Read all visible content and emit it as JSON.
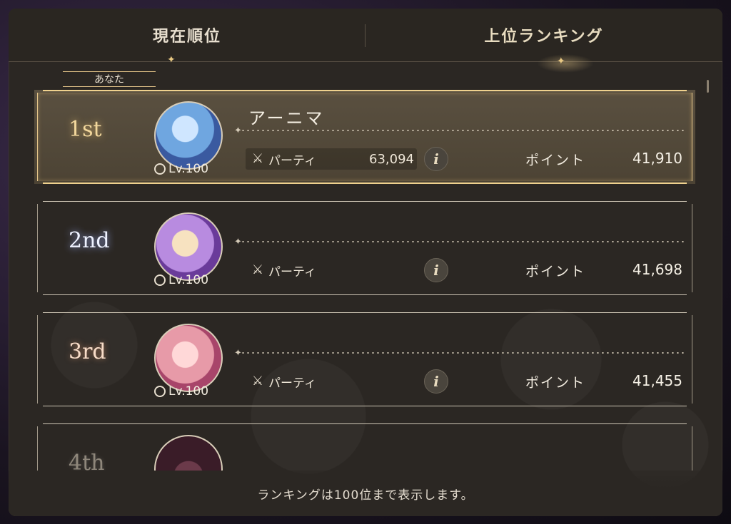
{
  "tabs": {
    "current": "現在順位",
    "top": "上位ランキング"
  },
  "you_tag": "あなた",
  "entries": [
    {
      "rank": "1st",
      "name": "アーニマ",
      "level": "Lv.100",
      "party_label": "パーティ",
      "party_value": "63,094",
      "point_label": "ポイント",
      "points": "41,910"
    },
    {
      "rank": "2nd",
      "name": "",
      "level": "Lv.100",
      "party_label": "パーティ",
      "party_value": "",
      "point_label": "ポイント",
      "points": "41,698"
    },
    {
      "rank": "3rd",
      "name": "",
      "level": "Lv.100",
      "party_label": "パーティ",
      "party_value": "",
      "point_label": "ポイント",
      "points": "41,455"
    },
    {
      "rank": "4th",
      "name": "",
      "level": "",
      "party_label": "",
      "party_value": "",
      "point_label": "",
      "points": ""
    }
  ],
  "footer": "ランキングは100位まで表示します。",
  "info_glyph": "i",
  "colors": {
    "gold": "#f0d28e",
    "panel": "#2b2723",
    "text": "#f4eee2"
  }
}
